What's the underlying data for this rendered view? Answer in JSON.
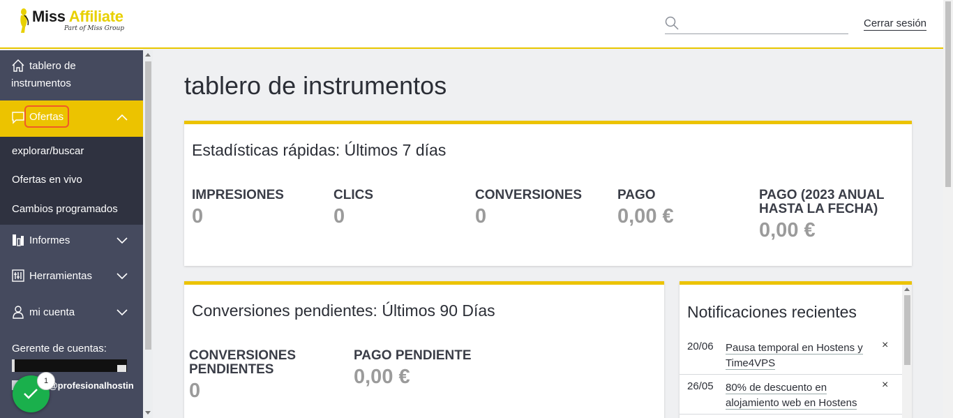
{
  "header": {
    "logo_text_a": "Miss",
    "logo_text_b": "Affiliate",
    "logo_sub": "Part of Miss Group",
    "search_placeholder": "",
    "logout_label": "Cerrar sesión"
  },
  "sidebar": {
    "home_line1": "tablero de",
    "home_line2": "instrumentos",
    "offers_label": "Ofertas",
    "sub_items": [
      "explorar/buscar",
      "Ofertas en vivo",
      "Cambios programados"
    ],
    "reports_label": "Informes",
    "tools_label": "Herramientas",
    "account_label": "mi cuenta",
    "manager_label": "Gerente de cuentas:",
    "manager_email": "@profesionalhostin"
  },
  "fab": {
    "badge": "1"
  },
  "main": {
    "page_title": "tablero de instrumentos",
    "quick_stats": {
      "title": "Estadísticas rápidas: Últimos 7 días",
      "items": [
        {
          "label": "IMPRESIONES",
          "value": "0"
        },
        {
          "label": "CLICS",
          "value": "0"
        },
        {
          "label": "CONVERSIONES",
          "value": "0"
        },
        {
          "label": "PAGO",
          "value": "0,00 €"
        },
        {
          "label": "PAGO (2023 ANUAL HASTA LA FECHA)",
          "value": "0,00 €"
        }
      ]
    },
    "pending": {
      "title": "Conversiones pendientes: Últimos 90 Días",
      "items": [
        {
          "label": "CONVERSIONES PENDIENTES",
          "value": "0"
        },
        {
          "label": "PAGO PENDIENTE",
          "value": "0,00 €"
        }
      ]
    },
    "notifications": {
      "title": "Notificaciones recientes",
      "items": [
        {
          "date": "20/06",
          "text": "Pausa temporal en Hostens y Time4VPS",
          "close": "×"
        },
        {
          "date": "26/05",
          "text": "80% de descuento en alojamiento web en Hostens",
          "close": "×"
        }
      ]
    }
  }
}
